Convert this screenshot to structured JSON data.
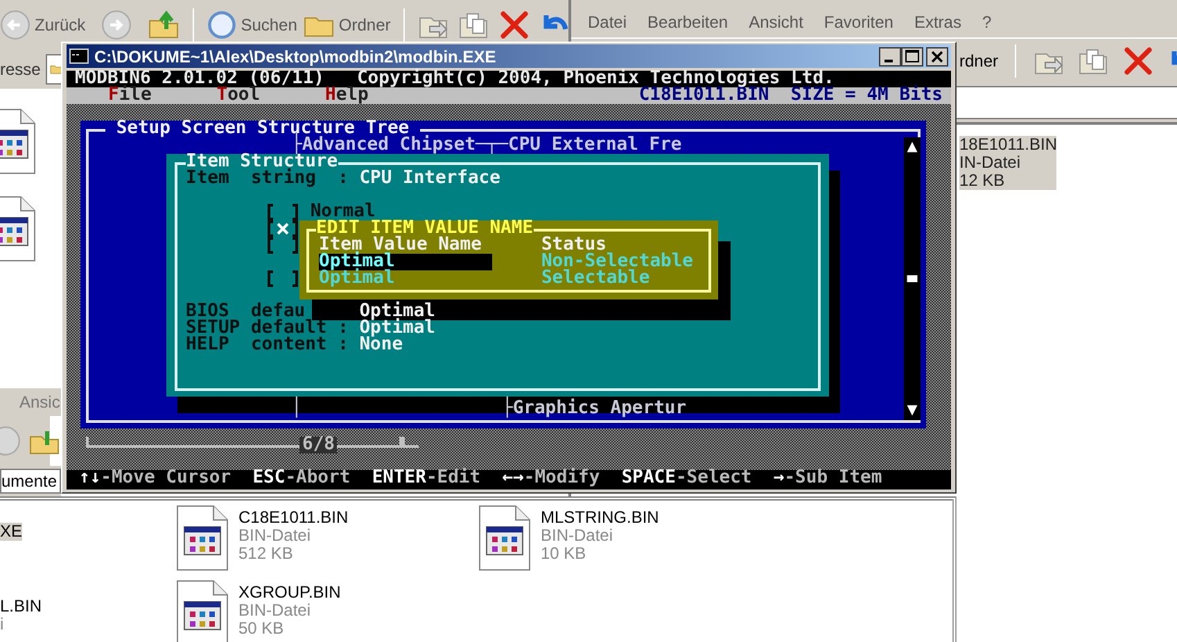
{
  "back_explorer": {
    "toolbar": {
      "back_label": "Zurück",
      "search_label": "Suchen",
      "folders_label": "Ordner"
    },
    "address_label": "resse",
    "view_label": "Ansic",
    "path_field_value": "umente",
    "files": [
      {
        "kind": "cut",
        "name": "XE",
        "selected": true
      },
      {
        "kind": "file",
        "name": "C18E1011.BIN",
        "type": "BIN-Datei",
        "size": "512 KB",
        "selected": false
      },
      {
        "kind": "file",
        "name": "MLSTRING.BIN",
        "type": "BIN-Datei",
        "size": "10 KB",
        "selected": false
      },
      {
        "kind": "cut",
        "name": "L.BIN",
        "type": "i",
        "selected": false
      },
      {
        "kind": "file",
        "name": "XGROUP.BIN",
        "type": "BIN-Datei",
        "size": "50 KB",
        "selected": false
      }
    ]
  },
  "front_explorer": {
    "menu": [
      "Datei",
      "Bearbeiten",
      "Ansicht",
      "Favoriten",
      "Extras",
      "?"
    ],
    "folders_label": "rdner",
    "files": [
      {
        "name": "18E1011.BIN",
        "type": "IN-Datei",
        "size": "12 KB",
        "selected": true
      }
    ]
  },
  "console": {
    "title": "C:\\DOKUME~1\\Alex\\Desktop\\modbin2\\modbin.EXE",
    "program": "MODBIN6 2.01.02 (06/11)",
    "copyright": "Copyright(c) 2004, Phoenix Technologies Ltd.",
    "menu": [
      {
        "hotkey": "F",
        "rest": "ile"
      },
      {
        "hotkey": "T",
        "rest": "ool"
      },
      {
        "hotkey": "H",
        "rest": "elp"
      }
    ],
    "file_name": "C18E1011.BIN",
    "size_info": "SIZE = 4M Bits",
    "tree": {
      "title": "Setup Screen Structure Tree",
      "top_branch": "├Advanced Chipset─┬─CPU External Fre",
      "bottom_stem": "│",
      "bottom_branch": "├Graphics Apertur",
      "page": "6/8"
    },
    "item_structure": {
      "title": "Item Structure",
      "item_string": {
        "label": "Item  string  :",
        "value": "CPU Interface"
      },
      "options": [
        {
          "label": "Normal",
          "checked": false
        },
        {
          "checked": true
        },
        {
          "checked": false
        },
        {
          "checked": false
        }
      ],
      "defaults": [
        {
          "label": "BIOS  defau",
          "value": "Optimal"
        },
        {
          "label": "SETUP default :",
          "value": "Optimal"
        },
        {
          "label": "HELP  content :",
          "value": "None"
        }
      ]
    },
    "dialog": {
      "title": "EDIT ITEM VALUE NAME",
      "columns": [
        "Item Value Name",
        "Status"
      ],
      "rows": [
        {
          "name": "Optimal",
          "status": "Non-Selectable",
          "selected": true
        },
        {
          "name": "Optimal",
          "status": "Selectable",
          "selected": false
        }
      ]
    },
    "help_keys": [
      {
        "key": "↑↓",
        "action": "-Move Cursor"
      },
      {
        "key": "ESC",
        "action": "-Abort"
      },
      {
        "key": "ENTER",
        "action": "-Edit"
      },
      {
        "key": "←→",
        "action": "-Modify"
      },
      {
        "key": "SPACE",
        "action": "-Select"
      },
      {
        "key": "→",
        "action": "-Sub Item"
      }
    ]
  }
}
